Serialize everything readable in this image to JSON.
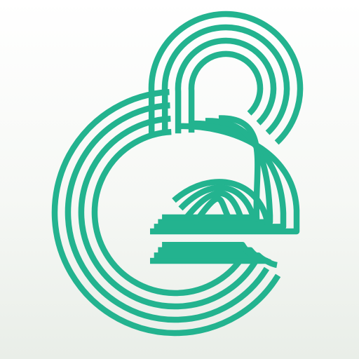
{
  "icon": {
    "name": "interlaced-line-monogram-logo-icon",
    "colors": {
      "stroke": "#23b38f",
      "background_top": "#ffffff",
      "background_bottom": "#e9eee8"
    }
  }
}
